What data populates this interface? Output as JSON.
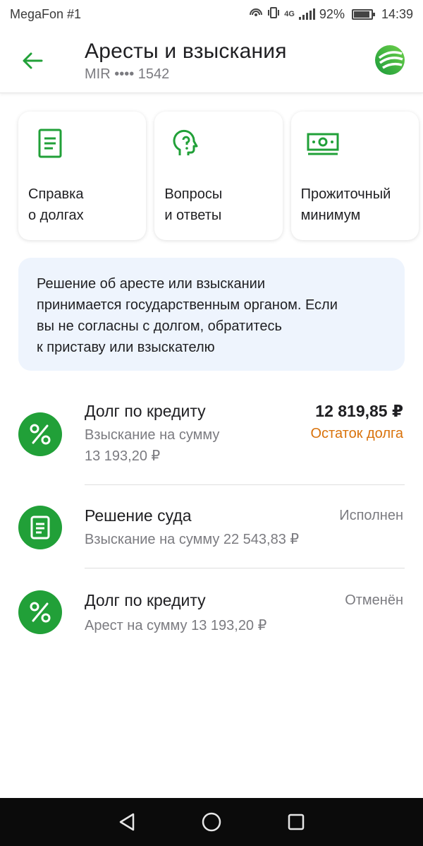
{
  "status_bar": {
    "carrier": "MegaFon #1",
    "network": "4G",
    "battery": "92%",
    "time": "14:39"
  },
  "header": {
    "title": "Аресты и взыскания",
    "subtitle": "MIR •••• 1542",
    "back_icon": "arrow-left-icon",
    "logo_icon": "sber-logo-icon"
  },
  "cards": [
    {
      "label": "Справка\nо долгах",
      "icon": "document-icon"
    },
    {
      "label": "Вопросы\nи ответы",
      "icon": "question-head-icon"
    },
    {
      "label": "Прожиточный\nминимум",
      "icon": "banknote-icon"
    }
  ],
  "notice": {
    "text": "Решение об аресте или взыскании\nпринимается государственным органом. Если\nвы не согласны с долгом, обратитесь\nк приставу или взыскателю"
  },
  "items": [
    {
      "title": "Долг по кредиту",
      "subtitle": "Взыскание на сумму\n13 193,20 ₽",
      "amount": "12 819,85 ₽",
      "status": "Остаток долга",
      "icon": "percent-icon"
    },
    {
      "title": "Решение суда",
      "subtitle": "Взыскание на сумму 22 543,83 ₽",
      "status": "Исполнен",
      "icon": "document-icon"
    },
    {
      "title": "Долг по кредиту",
      "subtitle": "Арест на сумму 13 193,20 ₽",
      "status": "Отменён",
      "icon": "percent-icon"
    }
  ],
  "colors": {
    "brand_green": "#21a038",
    "status_orange": "#d9720b",
    "notice_bg": "#eef4fd"
  }
}
